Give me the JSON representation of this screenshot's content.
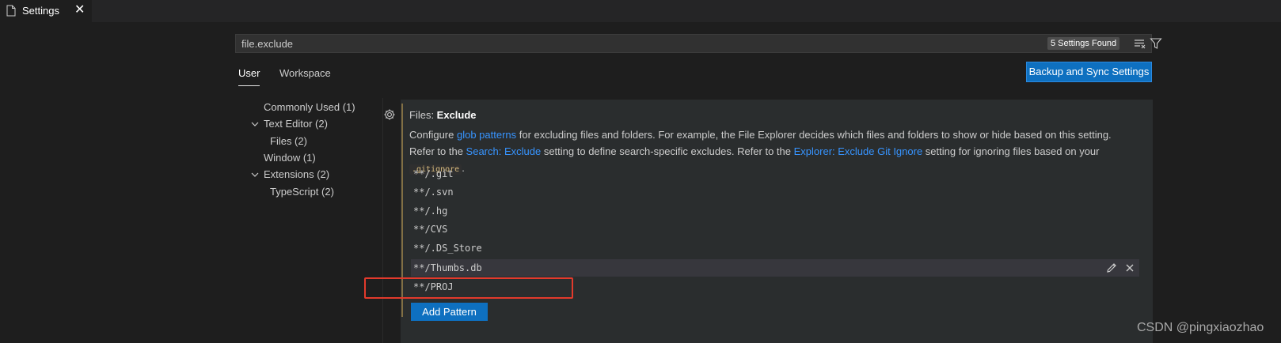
{
  "tab": {
    "title": "Settings",
    "close": "✕",
    "icon": "file-icon"
  },
  "search": {
    "value": "file.exclude",
    "results_badge": "5 Settings Found",
    "clear_icon": "clear-filter-icon",
    "filter_icon": "filter-icon"
  },
  "scope_tabs": {
    "user": "User",
    "workspace": "Workspace"
  },
  "sync_button": "Backup and Sync Settings",
  "toc": {
    "commonly_used": "Commonly Used (1)",
    "text_editor": "Text Editor (2)",
    "files": "Files (2)",
    "window": "Window (1)",
    "extensions": "Extensions (2)",
    "typescript": "TypeScript (2)"
  },
  "setting": {
    "category": "Files: ",
    "name": "Exclude",
    "desc_part1": "Configure ",
    "link_glob": "glob patterns",
    "desc_part2": " for excluding files and folders. For example, the File Explorer decides which files and folders to show or hide based on this setting. Refer to the ",
    "link_search_exclude": "Search: Exclude",
    "desc_part3": " setting to define search-specific excludes. Refer to the ",
    "link_explorer_gitignore": "Explorer: Exclude Git Ignore",
    "desc_part4": " setting for ignoring files based on your ",
    "code_gitignore": ".gitignore",
    "desc_part5": "."
  },
  "patterns": [
    "**/.git",
    "**/.svn",
    "**/.hg",
    "**/CVS",
    "**/.DS_Store",
    "**/Thumbs.db",
    "**/PROJ"
  ],
  "row_actions": {
    "edit_icon": "edit-pencil-icon",
    "remove_icon": "remove-icon"
  },
  "add_pattern_button": "Add Pattern",
  "watermark": "CSDN @pingxiaozhao",
  "colors": {
    "accent": "#0e70c0",
    "link": "#3794ff",
    "highlight": "#e23a2c",
    "modified_bar": "#c8a558"
  }
}
